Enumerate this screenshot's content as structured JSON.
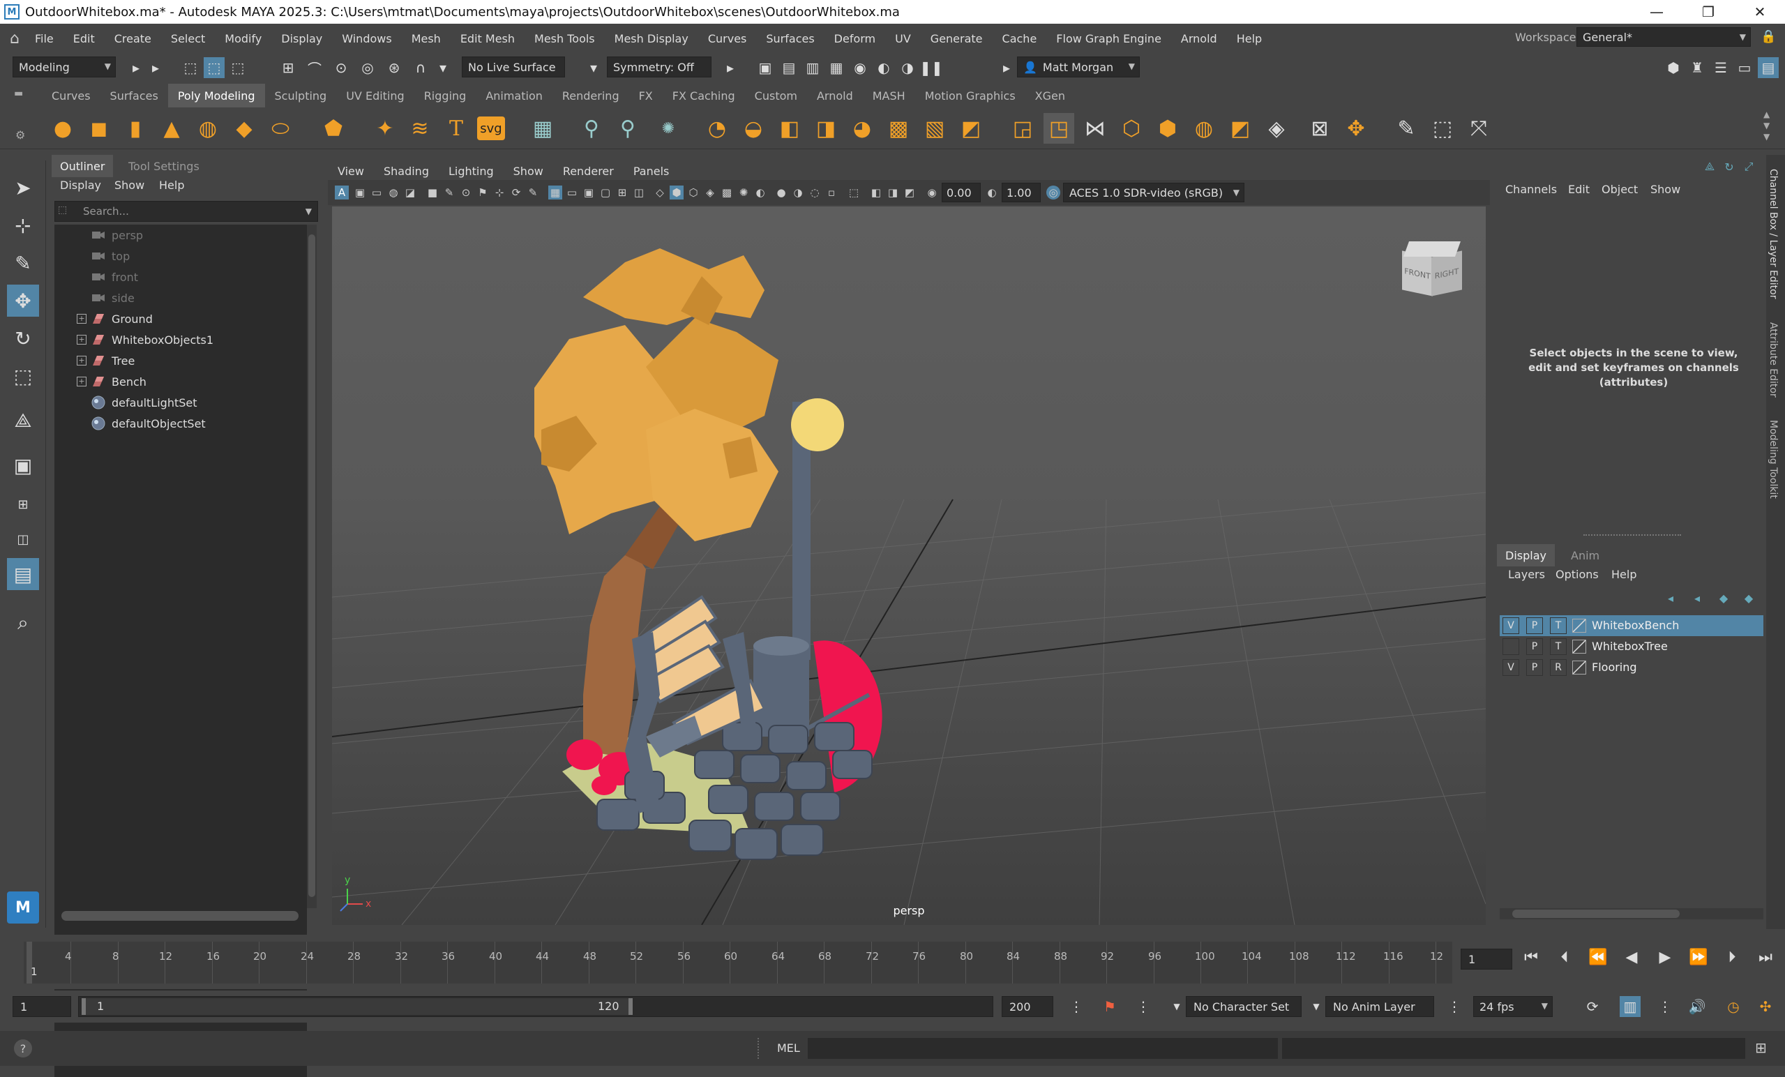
{
  "window": {
    "title": "OutdoorWhitebox.ma* - Autodesk MAYA 2025.3: C:\\Users\\mtmat\\Documents\\maya\\projects\\OutdoorWhitebox\\scenes\\OutdoorWhitebox.ma",
    "minimize": "—",
    "maximize": "❐",
    "close": "✕"
  },
  "menubar": {
    "items": [
      "File",
      "Edit",
      "Create",
      "Select",
      "Modify",
      "Display",
      "Windows",
      "Mesh",
      "Edit Mesh",
      "Mesh Tools",
      "Mesh Display",
      "Curves",
      "Surfaces",
      "Deform",
      "UV",
      "Generate",
      "Cache",
      "Flow Graph Engine",
      "Arnold",
      "Help"
    ],
    "workspace_label": "Workspace:",
    "workspace_value": "General*"
  },
  "statusline": {
    "mode": "Modeling",
    "live_surface": "No Live Surface",
    "symmetry": "Symmetry: Off",
    "user": "Matt Morgan"
  },
  "shelf": {
    "tabs": [
      "Curves",
      "Surfaces",
      "Poly Modeling",
      "Sculpting",
      "UV Editing",
      "Rigging",
      "Animation",
      "Rendering",
      "FX",
      "FX Caching",
      "Custom",
      "Arnold",
      "MASH",
      "Motion Graphics",
      "XGen"
    ],
    "active_tab": "Poly Modeling",
    "text_tool": "T",
    "svg_tool": "svg"
  },
  "outliner": {
    "tabs": [
      "Outliner",
      "Tool Settings"
    ],
    "menu": [
      "Display",
      "Show",
      "Help"
    ],
    "search_placeholder": "Search...",
    "items": [
      {
        "label": "persp",
        "type": "camera",
        "dim": true,
        "expand": false
      },
      {
        "label": "top",
        "type": "camera",
        "dim": true,
        "expand": false
      },
      {
        "label": "front",
        "type": "camera",
        "dim": true,
        "expand": false
      },
      {
        "label": "side",
        "type": "camera",
        "dim": true,
        "expand": false
      },
      {
        "label": "Ground",
        "type": "group",
        "dim": false,
        "expand": true
      },
      {
        "label": "WhiteboxObjects1",
        "type": "group",
        "dim": false,
        "expand": true
      },
      {
        "label": "Tree",
        "type": "group",
        "dim": false,
        "expand": true
      },
      {
        "label": "Bench",
        "type": "group",
        "dim": false,
        "expand": true
      },
      {
        "label": "defaultLightSet",
        "type": "set",
        "dim": false,
        "expand": false
      },
      {
        "label": "defaultObjectSet",
        "type": "set",
        "dim": false,
        "expand": false
      }
    ],
    "expand_glyph": "+"
  },
  "viewport": {
    "menu": [
      "View",
      "Shading",
      "Lighting",
      "Show",
      "Renderer",
      "Panels"
    ],
    "field_a": "0.00",
    "field_b": "1.00",
    "color_mgmt": "ACES 1.0 SDR-video (sRGB)",
    "camera": "persp",
    "viewcube_front": "FRONT",
    "viewcube_right": "RIGHT",
    "axis_x": "x",
    "axis_y": "y"
  },
  "channelbox": {
    "menu": [
      "Channels",
      "Edit",
      "Object",
      "Show"
    ],
    "empty_message": "Select objects in the scene to view, edit and set keyframes on channels (attributes)"
  },
  "layers": {
    "tabs": [
      "Display",
      "Anim"
    ],
    "menu": [
      "Layers",
      "Options",
      "Help"
    ],
    "rows": [
      {
        "v": "V",
        "p": "P",
        "t": "T",
        "name": "WhiteboxBench",
        "selected": true
      },
      {
        "v": "",
        "p": "P",
        "t": "T",
        "name": "WhiteboxTree",
        "selected": false
      },
      {
        "v": "V",
        "p": "P",
        "t": "R",
        "name": "Flooring",
        "selected": false
      }
    ]
  },
  "side_tabs": [
    "Channel Box / Layer Editor",
    "Attribute Editor",
    "Modeling Toolkit"
  ],
  "timeslider": {
    "ticks": [
      "4",
      "8",
      "12",
      "16",
      "20",
      "24",
      "28",
      "32",
      "36",
      "40",
      "44",
      "48",
      "52",
      "56",
      "60",
      "64",
      "68",
      "72",
      "76",
      "80",
      "84",
      "88",
      "92",
      "96",
      "100",
      "104",
      "108",
      "112",
      "116",
      "12"
    ],
    "current_frame": "1",
    "current_frame_field": "1"
  },
  "range": {
    "start": "1",
    "inner_start": "1",
    "inner_end": "120",
    "end": "200",
    "character_set": "No Character Set",
    "anim_layer": "No Anim Layer",
    "fps": "24 fps"
  },
  "cmdline": {
    "label": "MEL"
  },
  "colors": {
    "accent": "#5285a6",
    "selection": "#5285a6",
    "tree_foliage": "#e0a040",
    "tree_trunk": "#a06840",
    "pink": "#f0154f",
    "sun": "#f3d877",
    "stone": "#5a6678",
    "bench_wood": "#f0c890"
  }
}
